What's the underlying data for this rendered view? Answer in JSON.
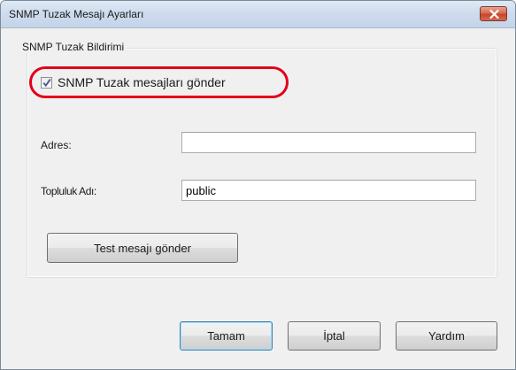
{
  "window": {
    "title": "SNMP Tuzak Mesajı Ayarları",
    "close_label": "Close"
  },
  "group": {
    "legend": "SNMP Tuzak Bildirimi",
    "checkbox_label": "SNMP Tuzak mesajları gönder",
    "checkbox_checked": true,
    "highlight_color": "#e2001a"
  },
  "fields": {
    "address_label": "Adres:",
    "address_value": "",
    "community_label": "Topluluk Adı:",
    "community_value": "public"
  },
  "buttons": {
    "test_label": "Test mesajı gönder",
    "ok_label": "Tamam",
    "cancel_label": "İptal",
    "help_label": "Yardım"
  },
  "colors": {
    "titlebar": "#cddbec",
    "dialog_bg": "#f0f0f0",
    "default_button_border": "#3c7fb1"
  }
}
